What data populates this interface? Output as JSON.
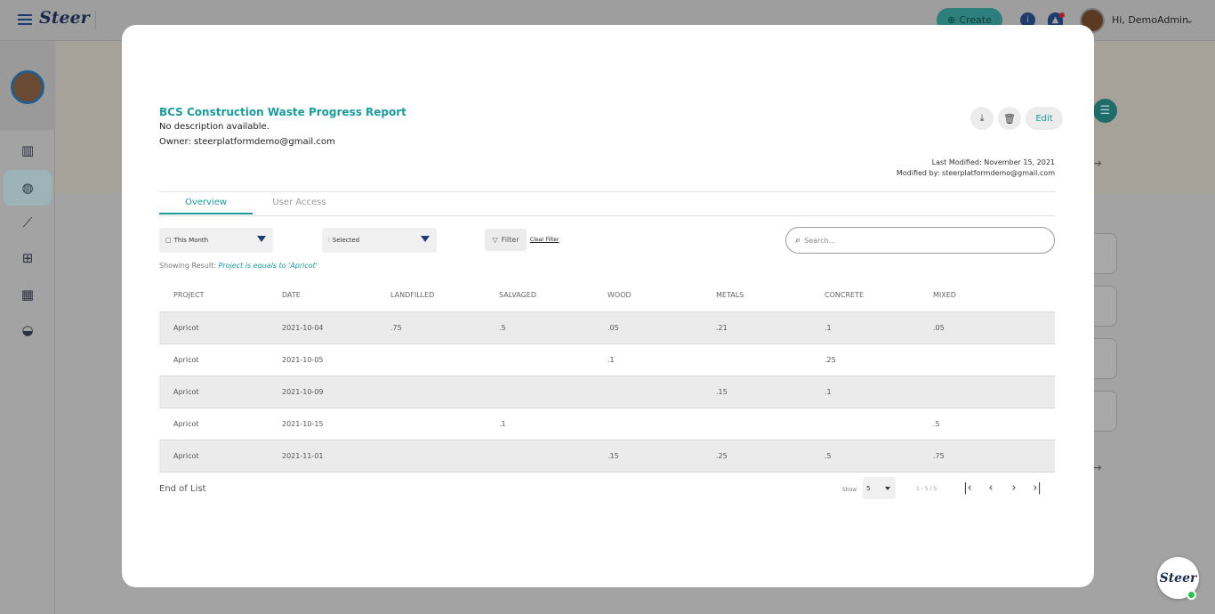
{
  "app": {
    "brand": "Steer",
    "create_label": "Create",
    "greeting": "Hi, DemoAdmin"
  },
  "report": {
    "title": "BCS Construction Waste Progress Report",
    "description": "No description available.",
    "owner": "Owner: steerplatformdemo@gmail.com",
    "edit_label": "Edit",
    "last_modified": "Last Modified: November 15, 2021",
    "modified_by": "Modified by: steerplatformdemo@gmail.com"
  },
  "tabs": [
    {
      "label": "Overview",
      "active": true
    },
    {
      "label": "User Access",
      "active": false
    }
  ],
  "filters": {
    "period_value": "This Month",
    "columns_value": "Selected",
    "filter_label": "Filter",
    "clear_label": "Clear Filter",
    "search_placeholder": "Search...",
    "showing_prefix": "Showing Result:",
    "showing_condition": "Project is equals to 'Apricot'"
  },
  "table": {
    "headers": [
      "PROJECT",
      "DATE",
      "LANDFILLED",
      "SALVAGED",
      "WOOD",
      "METALS",
      "CONCRETE",
      "MIXED"
    ],
    "rows": [
      [
        "Apricot",
        "2021-10-04",
        ".75",
        ".5",
        ".05",
        ".21",
        ".1",
        ".05"
      ],
      [
        "Apricot",
        "2021-10-05",
        "",
        "",
        ".1",
        "",
        ".25",
        ""
      ],
      [
        "Apricot",
        "2021-10-09",
        "",
        "",
        "",
        ".15",
        ".1",
        ""
      ],
      [
        "Apricot",
        "2021-10-15",
        "",
        ".1",
        "",
        "",
        "",
        ".5"
      ],
      [
        "Apricot",
        "2021-11-01",
        "",
        "",
        ".15",
        ".25",
        ".5",
        ".75"
      ]
    ]
  },
  "footer": {
    "end_label": "End of List",
    "show_label": "Show",
    "page_size": "5",
    "range": "1 - 5 / 5"
  },
  "colors": {
    "accent": "#199c9c",
    "nav_dark": "#1e3c6e"
  },
  "chat": {
    "label": "Steer"
  }
}
